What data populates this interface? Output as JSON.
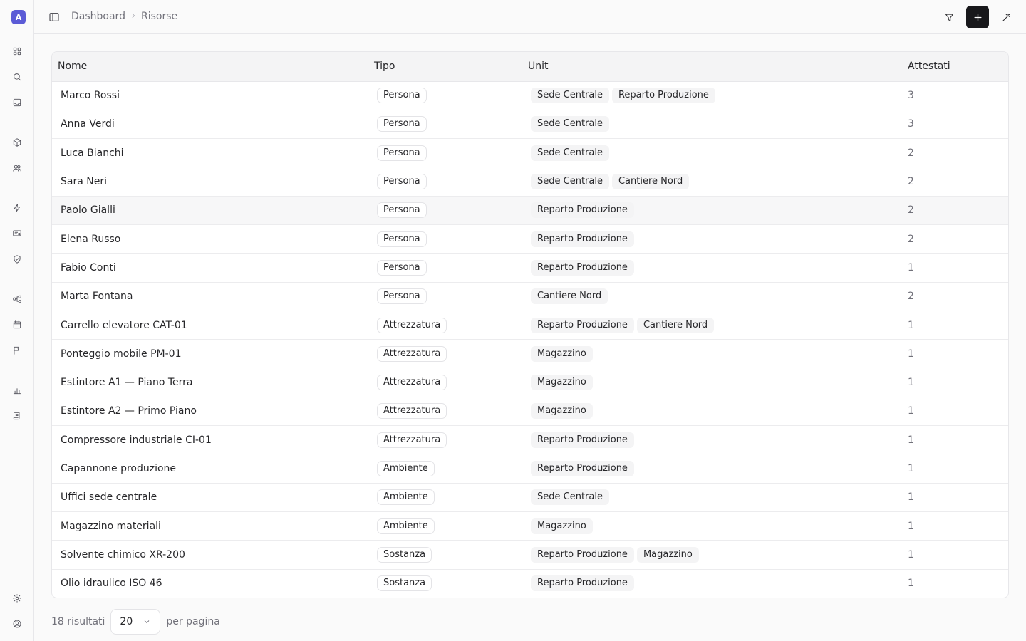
{
  "app": {
    "logo_letter": "A"
  },
  "header": {
    "breadcrumb": [
      "Dashboard",
      "Risorse"
    ]
  },
  "table": {
    "columns": [
      "Nome",
      "Tipo",
      "Unit",
      "Attestati"
    ],
    "rows": [
      {
        "nome": "Marco Rossi",
        "tipo": "Persona",
        "unit": [
          "Sede Centrale",
          "Reparto Produzione"
        ],
        "attestati": "3"
      },
      {
        "nome": "Anna Verdi",
        "tipo": "Persona",
        "unit": [
          "Sede Centrale"
        ],
        "attestati": "3"
      },
      {
        "nome": "Luca Bianchi",
        "tipo": "Persona",
        "unit": [
          "Sede Centrale"
        ],
        "attestati": "2"
      },
      {
        "nome": "Sara Neri",
        "tipo": "Persona",
        "unit": [
          "Sede Centrale",
          "Cantiere Nord"
        ],
        "attestati": "2"
      },
      {
        "nome": "Paolo Gialli",
        "tipo": "Persona",
        "unit": [
          "Reparto Produzione"
        ],
        "attestati": "2"
      },
      {
        "nome": "Elena Russo",
        "tipo": "Persona",
        "unit": [
          "Reparto Produzione"
        ],
        "attestati": "2"
      },
      {
        "nome": "Fabio Conti",
        "tipo": "Persona",
        "unit": [
          "Reparto Produzione"
        ],
        "attestati": "1"
      },
      {
        "nome": "Marta Fontana",
        "tipo": "Persona",
        "unit": [
          "Cantiere Nord"
        ],
        "attestati": "2"
      },
      {
        "nome": "Carrello elevatore CAT-01",
        "tipo": "Attrezzatura",
        "unit": [
          "Reparto Produzione",
          "Cantiere Nord"
        ],
        "attestati": "1"
      },
      {
        "nome": "Ponteggio mobile PM-01",
        "tipo": "Attrezzatura",
        "unit": [
          "Magazzino"
        ],
        "attestati": "1"
      },
      {
        "nome": "Estintore A1 — Piano Terra",
        "tipo": "Attrezzatura",
        "unit": [
          "Magazzino"
        ],
        "attestati": "1"
      },
      {
        "nome": "Estintore A2 — Primo Piano",
        "tipo": "Attrezzatura",
        "unit": [
          "Magazzino"
        ],
        "attestati": "1"
      },
      {
        "nome": "Compressore industriale CI-01",
        "tipo": "Attrezzatura",
        "unit": [
          "Reparto Produzione"
        ],
        "attestati": "1"
      },
      {
        "nome": "Capannone produzione",
        "tipo": "Ambiente",
        "unit": [
          "Reparto Produzione"
        ],
        "attestati": "1"
      },
      {
        "nome": "Uffici sede centrale",
        "tipo": "Ambiente",
        "unit": [
          "Sede Centrale"
        ],
        "attestati": "1"
      },
      {
        "nome": "Magazzino materiali",
        "tipo": "Ambiente",
        "unit": [
          "Magazzino"
        ],
        "attestati": "1"
      },
      {
        "nome": "Solvente chimico XR-200",
        "tipo": "Sostanza",
        "unit": [
          "Reparto Produzione",
          "Magazzino"
        ],
        "attestati": "1"
      },
      {
        "nome": "Olio idraulico ISO 46",
        "tipo": "Sostanza",
        "unit": [
          "Reparto Produzione"
        ],
        "attestati": "1"
      }
    ]
  },
  "footer": {
    "results": "18 risultati",
    "page_size": "20",
    "per_page": "per pagina"
  },
  "icons": {
    "sidebar": [
      "grid-icon",
      "search-icon",
      "inbox-icon",
      "box-icon",
      "users-icon",
      "zap-icon",
      "certificate-icon",
      "shield-check-icon",
      "workflow-icon",
      "calendar-icon",
      "flag-icon",
      "bar-chart-icon",
      "scroll-icon",
      "settings-icon",
      "user-circle-icon"
    ],
    "header": [
      "panel-left-icon",
      "chevron-right-icon",
      "filter-icon",
      "plus-icon",
      "wand-icon"
    ]
  },
  "colors": {
    "accent": "#5b5bd6",
    "primary_button": "#18181b"
  }
}
